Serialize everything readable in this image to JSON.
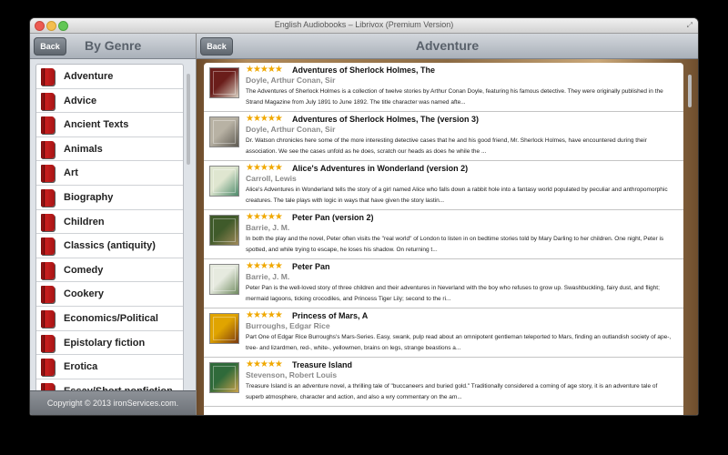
{
  "window": {
    "title": "English Audiobooks – Librivox (Premium Version)",
    "traffic_colors": [
      "#ec5b52",
      "#f4be4f",
      "#62c655"
    ]
  },
  "left_panel": {
    "back_label": "Back",
    "title": "By Genre",
    "genres": [
      "Adventure",
      "Advice",
      "Ancient Texts",
      "Animals",
      "Art",
      "Biography",
      "Children",
      "Classics (antiquity)",
      "Comedy",
      "Cookery",
      "Economics/Political",
      "Epistolary fiction",
      "Erotica",
      "Essay/Short nonfiction"
    ],
    "footer": "Copyright © 2013 ironServices.com."
  },
  "right_panel": {
    "back_label": "Back",
    "title": "Adventure",
    "books": [
      {
        "stars": "★★★★★",
        "title": "Adventures of Sherlock Holmes, The",
        "author": "Doyle, Arthur Conan, Sir",
        "description": "The Adventures of Sherlock Holmes is a collection of twelve stories by Arthur Conan Doyle, featuring his famous detective. They were originally published in the Strand Magazine from July 1891 to June 1892. The title character was named afte...",
        "cover_colors": [
          "#6a1d1a",
          "#d8cfc0"
        ]
      },
      {
        "stars": "★★★★★",
        "title": "Adventures of Sherlock Holmes, The (version 3)",
        "author": "Doyle, Arthur Conan, Sir",
        "description": "Dr. Watson chronicles here some of the more interesting detective cases that he and his good friend, Mr. Sherlock Holmes, have encountered during their association. We see the cases unfold as he does, scratch our heads as does he while the ...",
        "cover_colors": [
          "#b8b2a4",
          "#5e5a52"
        ]
      },
      {
        "stars": "★★★★★",
        "title": "Alice's Adventures in Wonderland (version 2)",
        "author": "Carroll, Lewis",
        "description": "Alice's Adventures in Wonderland tells the story of a girl named Alice who falls down a rabbit hole into a fantasy world populated by peculiar and anthropomorphic creatures. The tale plays with logic in ways that have given the story lastin...",
        "cover_colors": [
          "#dfe6d0",
          "#4d8a6a"
        ]
      },
      {
        "stars": "★★★★★",
        "title": "Peter Pan (version 2)",
        "author": "Barrie, J. M.",
        "description": "In both the play and the novel, Peter often visits the \"real world\" of London to listen in on bedtime stories told by Mary Darling to her children. One night, Peter is spotted, and while trying to escape, he loses his shadow. On returning t...",
        "cover_colors": [
          "#3f5a2a",
          "#a08a5a"
        ]
      },
      {
        "stars": "★★★★★",
        "title": "Peter Pan",
        "author": "Barrie, J. M.",
        "description": "Peter Pan is the well-loved story of three children and their adventures in Neverland with the boy who refuses to grow up. Swashbuckling, fairy dust, and flight; mermaid lagoons, ticking crocodiles, and Princess Tiger Lily; second to the ri...",
        "cover_colors": [
          "#e6eadf",
          "#6f8a5f"
        ]
      },
      {
        "stars": "★★★★★",
        "title": "Princess of Mars, A",
        "author": "Burroughs, Edgar Rice",
        "description": "Part One of Edgar Rice Burroughs's Mars-Series. Easy, swank, pulp read about an omnipotent gentleman teleported to Mars, finding an outlandish society of ape-, tree- and lizardmen, red-, white-, yellowmen, brains on legs, strange beastions a...",
        "cover_colors": [
          "#e0a400",
          "#7a3a10"
        ]
      },
      {
        "stars": "★★★★★",
        "title": "Treasure Island",
        "author": "Stevenson, Robert Louis",
        "description": "Treasure Island is an adventure novel, a thrilling tale of \"buccaneers and buried gold.\" Traditionally considered a coming of age story, it is an adventure tale of superb atmosphere, character and action, and also a wry commentary on the am...",
        "cover_colors": [
          "#2f6a3a",
          "#c8a14a"
        ]
      }
    ]
  }
}
